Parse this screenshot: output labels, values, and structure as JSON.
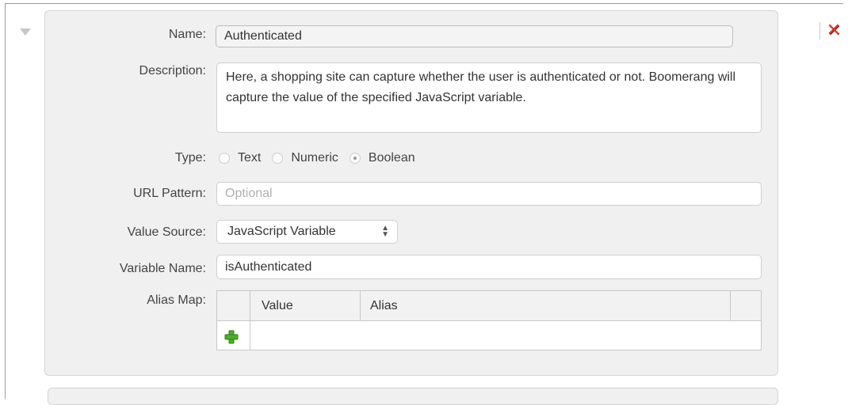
{
  "form": {
    "name_label": "Name:",
    "name_value": "Authenticated",
    "description_label": "Description:",
    "description_value": "Here, a shopping site can capture whether the user is authenticated or not. Boomerang will capture the value of the specified JavaScript variable.",
    "type_label": "Type:",
    "type_options": [
      "Text",
      "Numeric",
      "Boolean"
    ],
    "type_selected": "Boolean",
    "url_pattern_label": "URL Pattern:",
    "url_pattern_placeholder": "Optional",
    "value_source_label": "Value Source:",
    "value_source_selected": "JavaScript Variable",
    "variable_name_label": "Variable Name:",
    "variable_name_value": "isAuthenticated",
    "alias_map_label": "Alias Map:",
    "alias_map_columns": [
      "Value",
      "Alias"
    ]
  },
  "icons": {
    "collapse": "triangle-down-icon",
    "delete": "red-x-icon",
    "add_row": "green-plus-icon"
  },
  "colors": {
    "panel_bg": "#f0f0f0",
    "delete_red": "#d23a2a",
    "add_green": "#4caf28"
  }
}
